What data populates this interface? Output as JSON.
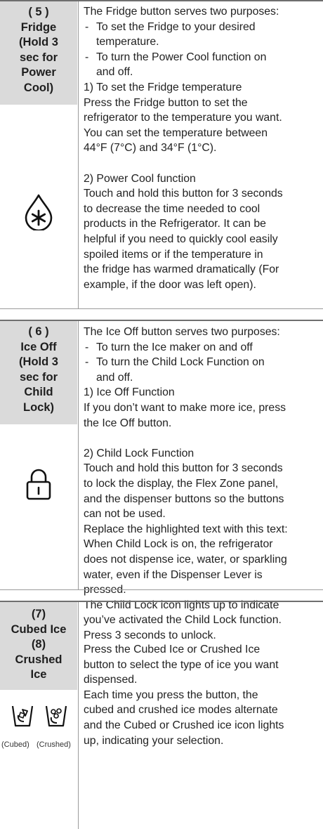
{
  "fridge": {
    "label_lines": [
      "( 5 )",
      "Fridge",
      "(Hold 3",
      "sec for",
      "Power",
      "Cool)"
    ],
    "icon": "fridge-power-cool-snowflake-drop-icon",
    "intro": "The Fridge button serves two purposes:",
    "bullets": [
      [
        "To set the Fridge to your desired",
        "temperature."
      ],
      [
        "To turn the Power Cool function on",
        "and off."
      ]
    ],
    "part1_heading": "1) To set the Fridge temperature",
    "part1_body": [
      "Press the Fridge button to set the",
      "refrigerator to the temperature you want.",
      "You can set the temperature between",
      "44°F (7°C) and 34°F (1°C)."
    ],
    "part2_heading": "2) Power Cool function",
    "part2_body": [
      "Touch and hold this button for 3 seconds",
      "to decrease the time needed to cool",
      "products in the Refrigerator. It can be",
      "helpful if you need to quickly cool easily",
      "spoiled items or if the temperature in",
      "the fridge has warmed dramatically (For",
      "example, if the door was left open)."
    ]
  },
  "iceoff": {
    "label_lines": [
      "( 6 )",
      "Ice Off",
      "(Hold 3",
      "sec for",
      "Child",
      "Lock)"
    ],
    "icon": "padlock-icon",
    "intro": "The Ice Off button serves two purposes:",
    "bullets": [
      [
        "To turn the Ice maker on and off"
      ],
      [
        "To turn the Child Lock Function on",
        "and off."
      ]
    ],
    "part1_heading": "1) Ice Off Function",
    "part1_body": [
      "If you don’t want to make more ice, press",
      "the Ice Off button."
    ],
    "part2_heading": "2) Child Lock Function",
    "part2_body": [
      "Touch and hold this button for 3 seconds",
      "to lock the display, the Flex Zone panel,",
      "and the dispenser buttons so the buttons",
      "can not be used.",
      "Replace the highlighted text with this text:",
      "When Child Lock is on, the refrigerator",
      "does not dispense ice, water, or sparkling",
      "water, even if the Dispenser Lever is",
      "pressed.",
      "The Child Lock icon lights up to indicate",
      "you’ve activated the Child Lock function.",
      "Press 3 seconds to unlock."
    ]
  },
  "ice": {
    "label_lines": [
      "(7)",
      "Cubed Ice",
      "(8)",
      "Crushed",
      "Ice"
    ],
    "icons": [
      "cubed-ice-glass-icon",
      "crushed-ice-glass-icon"
    ],
    "captions": [
      "(Cubed)",
      "(Crushed)"
    ],
    "body": [
      "Press the Cubed Ice or Crushed Ice",
      "button to select the type of ice you want",
      "dispensed.",
      "Each time you press the button, the",
      "cubed and crushed ice modes alternate",
      "and the Cubed or Crushed ice icon lights",
      "up, indicating your selection."
    ]
  }
}
